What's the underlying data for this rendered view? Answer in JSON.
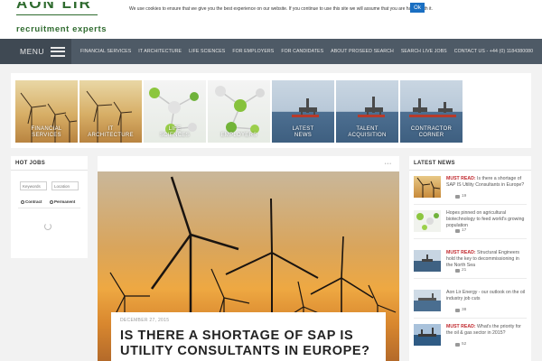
{
  "header": {
    "logo_top": "AON LIR",
    "logo_sub": "recruitment experts"
  },
  "cookie": {
    "text": "We use cookies to ensure that we give you the best experience on our website. If you continue to use this site we will assume that you are happy with it.",
    "ok_label": "Ok"
  },
  "nav": {
    "menu_label": "MENU",
    "items": [
      "FINANCIAL SERVICES",
      "IT ARCHITECTURE",
      "LIFE SCIENCES",
      "FOR EMPLOYERS",
      "FOR CANDIDATES",
      "ABOUT PROSEED SEARCH",
      "SEARCH LIVE JOBS",
      "CONTACT US - +44 (0) 1184380080"
    ]
  },
  "tiles": [
    {
      "label": "FINANCIAL\nSERVICES",
      "image": "wind"
    },
    {
      "label": "IT\nARCHITECTURE",
      "image": "wind"
    },
    {
      "label": "LIFE\nSCIENCES",
      "image": "chem"
    },
    {
      "label": "EMPLOYERS",
      "image": "chem"
    },
    {
      "label": "LATEST\nNEWS",
      "image": "sea"
    },
    {
      "label": "TALENT\nACQUISITION",
      "image": "sea"
    },
    {
      "label": "CONTRACTOR\nCORNER",
      "image": "sea"
    }
  ],
  "hotjobs": {
    "title": "HOT JOBS",
    "keywords_placeholder": "Keywords",
    "location_placeholder": "Location",
    "contract_label": "Contract",
    "permanent_label": "Permanent"
  },
  "article": {
    "date": "DECEMBER 27, 2015",
    "title": "IS THERE A SHORTAGE OF SAP IS UTILITY CONSULTANTS IN EUROPE?"
  },
  "latest": {
    "title": "LATEST NEWS",
    "items": [
      {
        "prefix": "MUST READ:",
        "text": "Is there a shortage of SAP IS Utility Consultants in Europe?",
        "count": "19",
        "thumb": "wind"
      },
      {
        "prefix": "",
        "text": "Hopes pinned on agricultural biotechnology to feed world's growing population",
        "count": "17",
        "thumb": "chem"
      },
      {
        "prefix": "MUST READ:",
        "text": "Structural Engineers hold the key to decommissioning in the North Sea",
        "count": "21",
        "thumb": "sea"
      },
      {
        "prefix": "",
        "text": "Aon Lir Energy - our outlook on the oil industry job cuts",
        "count": "38",
        "thumb": "sea"
      },
      {
        "prefix": "MUST READ:",
        "text": "What's the priority for the oil & gas sector in 2015?",
        "count": "52",
        "thumb": "sea"
      }
    ]
  }
}
